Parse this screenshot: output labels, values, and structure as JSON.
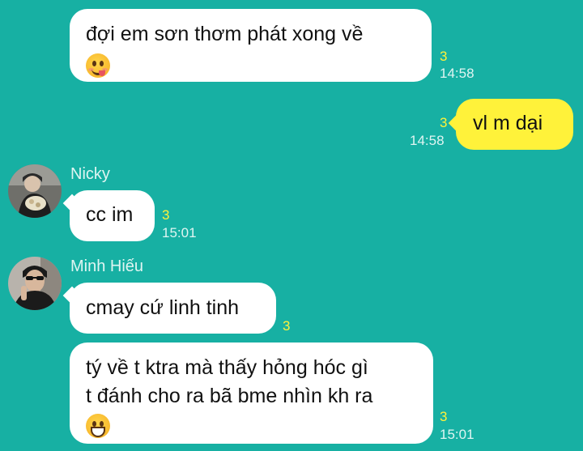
{
  "messages": [
    {
      "line1": "đợi em sơn thơm phát xong về",
      "emoji": "yum-face",
      "read": "3",
      "time": "14:58"
    },
    {
      "text": "vl m dại",
      "read": "3",
      "time": "14:58"
    },
    {
      "sender": "Nicky",
      "text": "cc im",
      "read": "3",
      "time": "15:01"
    },
    {
      "sender": "Minh Hiếu",
      "text": "cmay cứ linh tinh",
      "read": "3"
    },
    {
      "line1": "tý về t ktra mà thấy hỏng hóc gì",
      "line2": "t đánh cho ra bã bme nhìn kh ra",
      "emoji": "grinning-face",
      "read": "3",
      "time": "15:01"
    }
  ],
  "colors": {
    "background": "#17b0a3",
    "incoming": "#ffffff",
    "outgoing": "#fff23a",
    "read_count": "#fff23a"
  }
}
